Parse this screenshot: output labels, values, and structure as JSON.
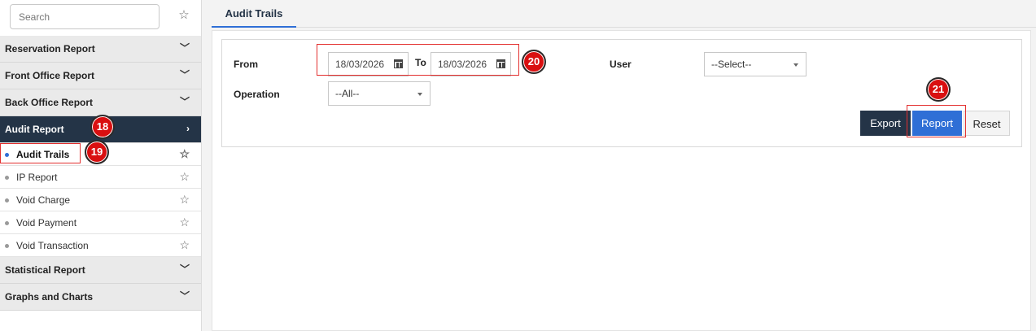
{
  "sidebar": {
    "search_placeholder": "Search",
    "favorite_icon": "star-outline-icon",
    "groups": [
      {
        "label": "Reservation Report"
      },
      {
        "label": "Front Office Report"
      },
      {
        "label": "Back Office Report"
      },
      {
        "label": "Audit Report"
      },
      {
        "label": "Statistical Report"
      },
      {
        "label": "Graphs and Charts"
      }
    ],
    "audit_items": [
      {
        "label": "Audit Trails"
      },
      {
        "label": "IP Report"
      },
      {
        "label": "Void Charge"
      },
      {
        "label": "Void Payment"
      },
      {
        "label": "Void Transaction"
      }
    ]
  },
  "main": {
    "tab_label": "Audit Trails",
    "form": {
      "from_label": "From",
      "from_value": "18/03/2026",
      "to_label": "To",
      "to_value": "18/03/2026",
      "user_label": "User",
      "user_value": "--Select--",
      "operation_label": "Operation",
      "operation_value": "--All--"
    },
    "buttons": {
      "export": "Export",
      "report": "Report",
      "reset": "Reset"
    }
  },
  "annotations": {
    "b18": "18",
    "b19": "19",
    "b20": "20",
    "b21": "21"
  },
  "colors": {
    "active_nav": "#243447",
    "primary": "#2f6fd6",
    "annotation": "#d90f10"
  }
}
